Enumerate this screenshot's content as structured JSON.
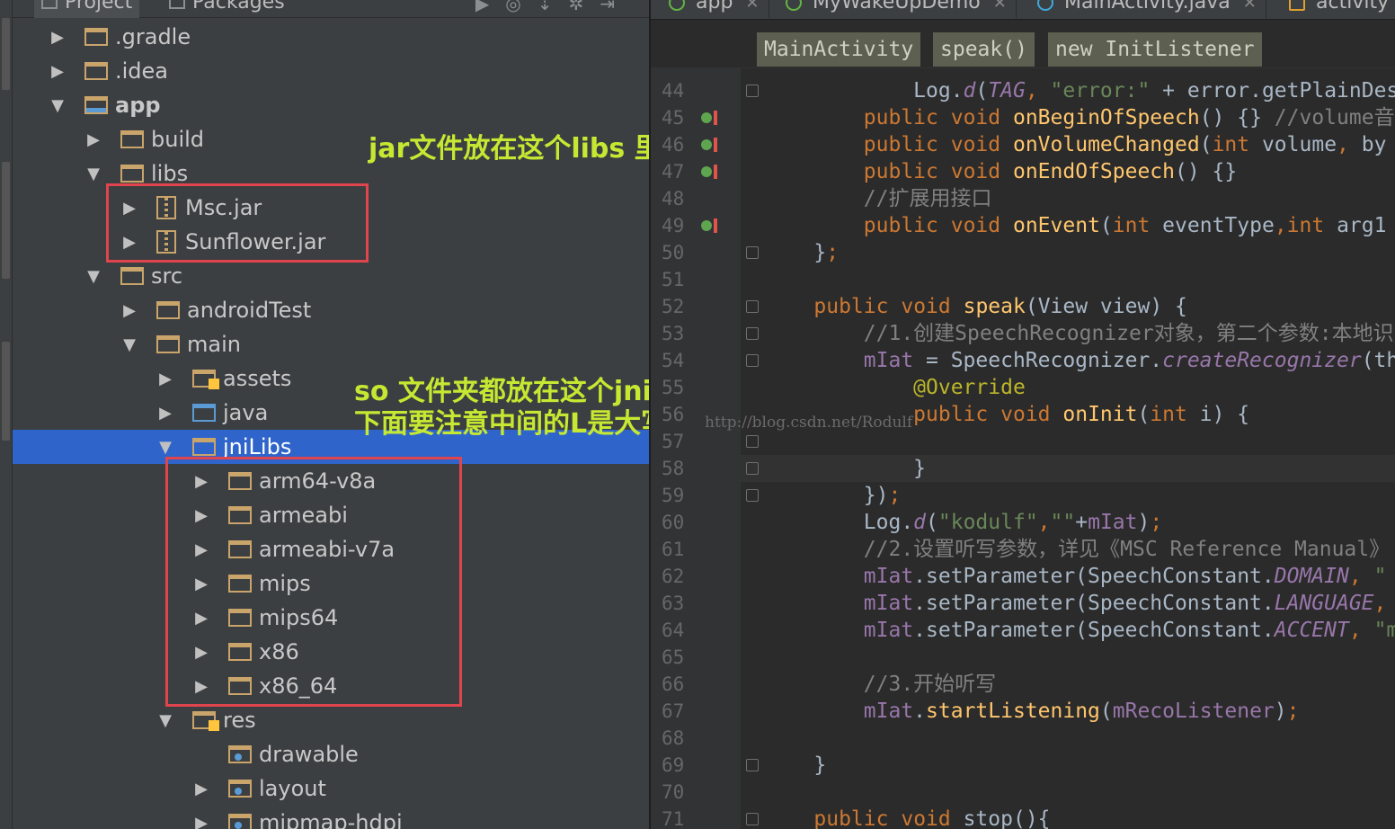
{
  "project_panel": {
    "tabs": [
      "Project",
      "Packages"
    ],
    "tree": [
      {
        "label": ".gradle",
        "arrow": "▶",
        "icon": "folder-icon"
      },
      {
        "label": ".idea",
        "arrow": "▶",
        "icon": "folder-icon"
      },
      {
        "label": "app",
        "arrow": "▼",
        "icon": "module-folder-icon"
      },
      {
        "label": "build",
        "arrow": "▶",
        "icon": "folder-icon"
      },
      {
        "label": "libs",
        "arrow": "▼",
        "icon": "folder-icon"
      },
      {
        "label": "Msc.jar",
        "arrow": "▶",
        "icon": "jar-icon"
      },
      {
        "label": "Sunflower.jar",
        "arrow": "▶",
        "icon": "jar-icon"
      },
      {
        "label": "src",
        "arrow": "▼",
        "icon": "folder-icon"
      },
      {
        "label": "androidTest",
        "arrow": "▶",
        "icon": "folder-icon"
      },
      {
        "label": "main",
        "arrow": "▼",
        "icon": "folder-icon"
      },
      {
        "label": "assets",
        "arrow": "▶",
        "icon": "assets-folder-icon"
      },
      {
        "label": "java",
        "arrow": "▶",
        "icon": "source-folder-icon"
      },
      {
        "label": "jniLibs",
        "arrow": "▼",
        "icon": "folder-icon"
      },
      {
        "label": "arm64-v8a",
        "arrow": "▶",
        "icon": "folder-icon"
      },
      {
        "label": "armeabi",
        "arrow": "▶",
        "icon": "folder-icon"
      },
      {
        "label": "armeabi-v7a",
        "arrow": "▶",
        "icon": "folder-icon"
      },
      {
        "label": "mips",
        "arrow": "▶",
        "icon": "folder-icon"
      },
      {
        "label": "mips64",
        "arrow": "▶",
        "icon": "folder-icon"
      },
      {
        "label": "x86",
        "arrow": "▶",
        "icon": "folder-icon"
      },
      {
        "label": "x86_64",
        "arrow": "▶",
        "icon": "folder-icon"
      },
      {
        "label": "res",
        "arrow": "▼",
        "icon": "resources-folder-icon"
      },
      {
        "label": "drawable",
        "arrow": "",
        "icon": "res-folder-icon"
      },
      {
        "label": "layout",
        "arrow": "▶",
        "icon": "res-folder-icon"
      },
      {
        "label": "mipmap-hdpi",
        "arrow": "▶",
        "icon": "res-folder-icon"
      }
    ],
    "selected": "jniLibs"
  },
  "annotations": {
    "jar_note": "jar文件放在这个libs 里面",
    "so_note_line1": "so 文件夹都放在这个jniLibs",
    "so_note_line2": "下面要注意中间的L是大写的"
  },
  "editor": {
    "tabs": [
      "app",
      "MyWakeUpDemo",
      "MainActivity.java",
      "activity"
    ],
    "breadcrumbs": [
      "MainActivity",
      "speak()",
      "new InitListener"
    ],
    "watermark": "http://blog.csdn.net/Rodulf",
    "line_numbers": [
      "44",
      "45",
      "46",
      "47",
      "48",
      "49",
      "50",
      "51",
      "52",
      "53",
      "54",
      "55",
      "56",
      "57",
      "58",
      "59",
      "60",
      "61",
      "62",
      "63",
      "64",
      "65",
      "66",
      "67",
      "68",
      "69",
      "70",
      "71"
    ],
    "code_lines": [
      "            Log.d(TAG, \"error:\" + error.getPlainDes",
      "        public void onBeginOfSpeech() {} //volume音",
      "        public void onVolumeChanged(int volume, by",
      "        public void onEndOfSpeech() {}",
      "        //扩展用接口",
      "        public void onEvent(int eventType,int arg1",
      "    };",
      "",
      "    public void speak(View view) {",
      "        //1.创建SpeechRecognizer对象，第二个参数:本地识",
      "        mIat = SpeechRecognizer.createRecognizer(th",
      "            @Override",
      "            public void onInit(int i) {",
      "",
      "            }",
      "        });",
      "        Log.d(\"kodulf\",\"\"+mIat);",
      "        //2.设置听写参数，详见《MSC Reference Manual》",
      "        mIat.setParameter(SpeechConstant.DOMAIN, \"",
      "        mIat.setParameter(SpeechConstant.LANGUAGE,",
      "        mIat.setParameter(SpeechConstant.ACCENT, \"m",
      "",
      "        //3.开始听写",
      "        mIat.startListening(mRecoListener);",
      "",
      "    }",
      "",
      "    public void stop(){"
    ]
  }
}
